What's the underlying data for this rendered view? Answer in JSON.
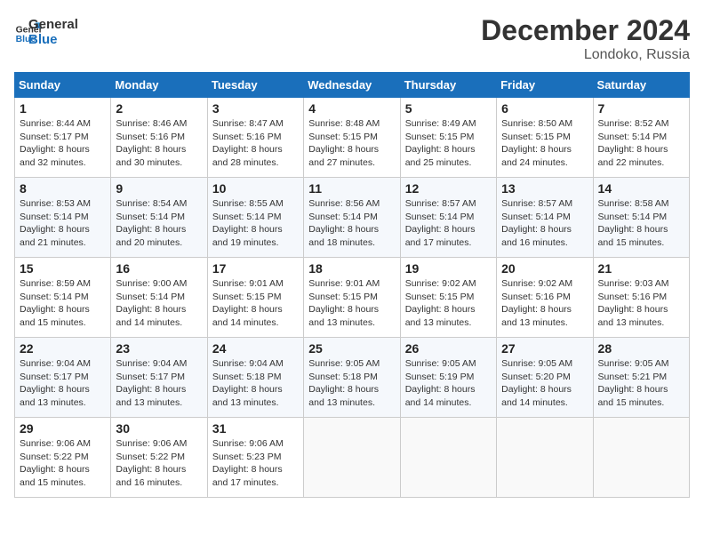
{
  "logo": {
    "line1": "General",
    "line2": "Blue"
  },
  "title": "December 2024",
  "subtitle": "Londoko, Russia",
  "weekdays": [
    "Sunday",
    "Monday",
    "Tuesday",
    "Wednesday",
    "Thursday",
    "Friday",
    "Saturday"
  ],
  "weeks": [
    [
      {
        "day": "1",
        "sunrise": "Sunrise: 8:44 AM",
        "sunset": "Sunset: 5:17 PM",
        "daylight": "Daylight: 8 hours and 32 minutes."
      },
      {
        "day": "2",
        "sunrise": "Sunrise: 8:46 AM",
        "sunset": "Sunset: 5:16 PM",
        "daylight": "Daylight: 8 hours and 30 minutes."
      },
      {
        "day": "3",
        "sunrise": "Sunrise: 8:47 AM",
        "sunset": "Sunset: 5:16 PM",
        "daylight": "Daylight: 8 hours and 28 minutes."
      },
      {
        "day": "4",
        "sunrise": "Sunrise: 8:48 AM",
        "sunset": "Sunset: 5:15 PM",
        "daylight": "Daylight: 8 hours and 27 minutes."
      },
      {
        "day": "5",
        "sunrise": "Sunrise: 8:49 AM",
        "sunset": "Sunset: 5:15 PM",
        "daylight": "Daylight: 8 hours and 25 minutes."
      },
      {
        "day": "6",
        "sunrise": "Sunrise: 8:50 AM",
        "sunset": "Sunset: 5:15 PM",
        "daylight": "Daylight: 8 hours and 24 minutes."
      },
      {
        "day": "7",
        "sunrise": "Sunrise: 8:52 AM",
        "sunset": "Sunset: 5:14 PM",
        "daylight": "Daylight: 8 hours and 22 minutes."
      }
    ],
    [
      {
        "day": "8",
        "sunrise": "Sunrise: 8:53 AM",
        "sunset": "Sunset: 5:14 PM",
        "daylight": "Daylight: 8 hours and 21 minutes."
      },
      {
        "day": "9",
        "sunrise": "Sunrise: 8:54 AM",
        "sunset": "Sunset: 5:14 PM",
        "daylight": "Daylight: 8 hours and 20 minutes."
      },
      {
        "day": "10",
        "sunrise": "Sunrise: 8:55 AM",
        "sunset": "Sunset: 5:14 PM",
        "daylight": "Daylight: 8 hours and 19 minutes."
      },
      {
        "day": "11",
        "sunrise": "Sunrise: 8:56 AM",
        "sunset": "Sunset: 5:14 PM",
        "daylight": "Daylight: 8 hours and 18 minutes."
      },
      {
        "day": "12",
        "sunrise": "Sunrise: 8:57 AM",
        "sunset": "Sunset: 5:14 PM",
        "daylight": "Daylight: 8 hours and 17 minutes."
      },
      {
        "day": "13",
        "sunrise": "Sunrise: 8:57 AM",
        "sunset": "Sunset: 5:14 PM",
        "daylight": "Daylight: 8 hours and 16 minutes."
      },
      {
        "day": "14",
        "sunrise": "Sunrise: 8:58 AM",
        "sunset": "Sunset: 5:14 PM",
        "daylight": "Daylight: 8 hours and 15 minutes."
      }
    ],
    [
      {
        "day": "15",
        "sunrise": "Sunrise: 8:59 AM",
        "sunset": "Sunset: 5:14 PM",
        "daylight": "Daylight: 8 hours and 15 minutes."
      },
      {
        "day": "16",
        "sunrise": "Sunrise: 9:00 AM",
        "sunset": "Sunset: 5:14 PM",
        "daylight": "Daylight: 8 hours and 14 minutes."
      },
      {
        "day": "17",
        "sunrise": "Sunrise: 9:01 AM",
        "sunset": "Sunset: 5:15 PM",
        "daylight": "Daylight: 8 hours and 14 minutes."
      },
      {
        "day": "18",
        "sunrise": "Sunrise: 9:01 AM",
        "sunset": "Sunset: 5:15 PM",
        "daylight": "Daylight: 8 hours and 13 minutes."
      },
      {
        "day": "19",
        "sunrise": "Sunrise: 9:02 AM",
        "sunset": "Sunset: 5:15 PM",
        "daylight": "Daylight: 8 hours and 13 minutes."
      },
      {
        "day": "20",
        "sunrise": "Sunrise: 9:02 AM",
        "sunset": "Sunset: 5:16 PM",
        "daylight": "Daylight: 8 hours and 13 minutes."
      },
      {
        "day": "21",
        "sunrise": "Sunrise: 9:03 AM",
        "sunset": "Sunset: 5:16 PM",
        "daylight": "Daylight: 8 hours and 13 minutes."
      }
    ],
    [
      {
        "day": "22",
        "sunrise": "Sunrise: 9:04 AM",
        "sunset": "Sunset: 5:17 PM",
        "daylight": "Daylight: 8 hours and 13 minutes."
      },
      {
        "day": "23",
        "sunrise": "Sunrise: 9:04 AM",
        "sunset": "Sunset: 5:17 PM",
        "daylight": "Daylight: 8 hours and 13 minutes."
      },
      {
        "day": "24",
        "sunrise": "Sunrise: 9:04 AM",
        "sunset": "Sunset: 5:18 PM",
        "daylight": "Daylight: 8 hours and 13 minutes."
      },
      {
        "day": "25",
        "sunrise": "Sunrise: 9:05 AM",
        "sunset": "Sunset: 5:18 PM",
        "daylight": "Daylight: 8 hours and 13 minutes."
      },
      {
        "day": "26",
        "sunrise": "Sunrise: 9:05 AM",
        "sunset": "Sunset: 5:19 PM",
        "daylight": "Daylight: 8 hours and 14 minutes."
      },
      {
        "day": "27",
        "sunrise": "Sunrise: 9:05 AM",
        "sunset": "Sunset: 5:20 PM",
        "daylight": "Daylight: 8 hours and 14 minutes."
      },
      {
        "day": "28",
        "sunrise": "Sunrise: 9:05 AM",
        "sunset": "Sunset: 5:21 PM",
        "daylight": "Daylight: 8 hours and 15 minutes."
      }
    ],
    [
      {
        "day": "29",
        "sunrise": "Sunrise: 9:06 AM",
        "sunset": "Sunset: 5:22 PM",
        "daylight": "Daylight: 8 hours and 15 minutes."
      },
      {
        "day": "30",
        "sunrise": "Sunrise: 9:06 AM",
        "sunset": "Sunset: 5:22 PM",
        "daylight": "Daylight: 8 hours and 16 minutes."
      },
      {
        "day": "31",
        "sunrise": "Sunrise: 9:06 AM",
        "sunset": "Sunset: 5:23 PM",
        "daylight": "Daylight: 8 hours and 17 minutes."
      },
      null,
      null,
      null,
      null
    ]
  ]
}
